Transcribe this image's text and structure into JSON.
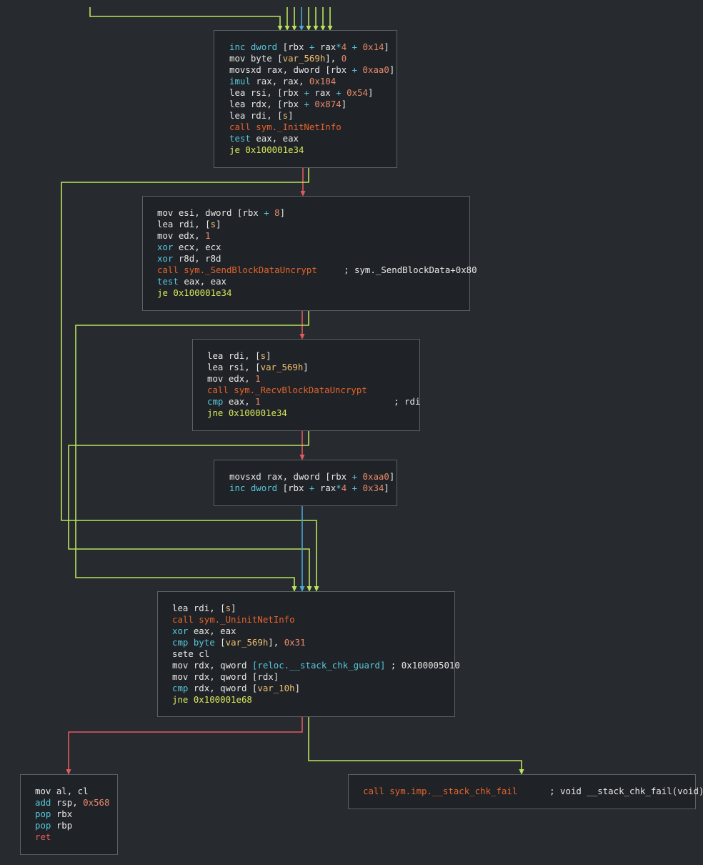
{
  "colors": {
    "bg": "#272b2f",
    "node_bg": "#1f2226",
    "node_border": "#5c6166",
    "edge_true": "#b9e35c",
    "edge_false": "#e0595f",
    "edge_uncond": "#4aa8d4",
    "text": "#e8e8e8",
    "register_keyword": "#56c8dc",
    "call": "#e8642c",
    "jump": "#d8e85c",
    "ret": "#e85c5c",
    "number": "#e88a6c",
    "var": "#f0c070"
  },
  "nodes": {
    "init": {
      "lines": [
        [
          [
            "inc dword ",
            "c"
          ],
          [
            "[",
            "w"
          ],
          [
            "rbx",
            "w"
          ],
          [
            " + ",
            "c"
          ],
          [
            "rax",
            "w"
          ],
          [
            "*",
            "c"
          ],
          [
            "4",
            "n"
          ],
          [
            " + ",
            "c"
          ],
          [
            "0x14",
            "n"
          ],
          [
            "]",
            "w"
          ]
        ],
        [
          [
            "mov byte ",
            "w"
          ],
          [
            "[",
            "w"
          ],
          [
            "var_569h",
            "y"
          ],
          [
            "], ",
            "w"
          ],
          [
            "0",
            "n"
          ]
        ],
        [
          [
            "movsxd rax, dword ",
            "w"
          ],
          [
            "[",
            "w"
          ],
          [
            "rbx",
            "w"
          ],
          [
            " + ",
            "c"
          ],
          [
            "0xaa0",
            "n"
          ],
          [
            "]",
            "w"
          ]
        ],
        [
          [
            "imul ",
            "c"
          ],
          [
            "rax, rax, ",
            "w"
          ],
          [
            "0x104",
            "n"
          ]
        ],
        [
          [
            "lea rsi, ",
            "w"
          ],
          [
            "[",
            "w"
          ],
          [
            "rbx",
            "w"
          ],
          [
            " + ",
            "c"
          ],
          [
            "rax",
            "w"
          ],
          [
            " + ",
            "c"
          ],
          [
            "0x54",
            "n"
          ],
          [
            "]",
            "w"
          ]
        ],
        [
          [
            "lea rdx, ",
            "w"
          ],
          [
            "[",
            "w"
          ],
          [
            "rbx",
            "w"
          ],
          [
            " + ",
            "c"
          ],
          [
            "0x874",
            "n"
          ],
          [
            "]",
            "w"
          ]
        ],
        [
          [
            "lea rdi, ",
            "w"
          ],
          [
            "[",
            "w"
          ],
          [
            "s",
            "y"
          ],
          [
            "]",
            "w"
          ]
        ],
        [
          [
            "call sym._InitNetInfo",
            "o"
          ]
        ],
        [
          [
            "test ",
            "c"
          ],
          [
            "eax, eax",
            "w"
          ]
        ],
        [
          [
            "je 0x100001e34",
            "g"
          ]
        ]
      ]
    },
    "send": {
      "lines": [
        [
          [
            "mov esi, dword ",
            "w"
          ],
          [
            "[",
            "w"
          ],
          [
            "rbx",
            "w"
          ],
          [
            " + ",
            "c"
          ],
          [
            "8",
            "n"
          ],
          [
            "]",
            "w"
          ]
        ],
        [
          [
            "lea rdi, ",
            "w"
          ],
          [
            "[",
            "w"
          ],
          [
            "s",
            "y"
          ],
          [
            "]",
            "w"
          ]
        ],
        [
          [
            "mov edx, ",
            "w"
          ],
          [
            "1",
            "n"
          ]
        ],
        [
          [
            "xor ",
            "c"
          ],
          [
            "ecx, ecx",
            "w"
          ]
        ],
        [
          [
            "xor ",
            "c"
          ],
          [
            "r8d, r8d",
            "w"
          ]
        ],
        [
          [
            "call sym._SendBlockDataUncrypt",
            "o"
          ],
          [
            "     ; sym._SendBlockData+0x80",
            "w"
          ]
        ],
        [
          [
            "test ",
            "c"
          ],
          [
            "eax, eax",
            "w"
          ]
        ],
        [
          [
            "je 0x100001e34",
            "g"
          ]
        ]
      ]
    },
    "recv": {
      "lines": [
        [
          [
            "lea rdi, ",
            "w"
          ],
          [
            "[",
            "w"
          ],
          [
            "s",
            "y"
          ],
          [
            "]",
            "w"
          ]
        ],
        [
          [
            "lea rsi, ",
            "w"
          ],
          [
            "[",
            "w"
          ],
          [
            "var_569h",
            "y"
          ],
          [
            "]",
            "w"
          ]
        ],
        [
          [
            "mov edx, ",
            "w"
          ],
          [
            "1",
            "n"
          ]
        ],
        [
          [
            "call sym._RecvBlockDataUncrypt",
            "o"
          ]
        ],
        [
          [
            "cmp ",
            "c"
          ],
          [
            "eax, ",
            "w"
          ],
          [
            "1",
            "n"
          ],
          [
            "                         ; rdi",
            "w"
          ]
        ],
        [
          [
            "jne 0x100001e34",
            "g"
          ]
        ]
      ]
    },
    "incr": {
      "lines": [
        [
          [
            "movsxd rax, dword ",
            "w"
          ],
          [
            "[",
            "w"
          ],
          [
            "rbx",
            "w"
          ],
          [
            " + ",
            "c"
          ],
          [
            "0xaa0",
            "n"
          ],
          [
            "]",
            "w"
          ]
        ],
        [
          [
            "inc dword ",
            "c"
          ],
          [
            "[",
            "w"
          ],
          [
            "rbx",
            "w"
          ],
          [
            " + ",
            "c"
          ],
          [
            "rax",
            "w"
          ],
          [
            "*",
            "c"
          ],
          [
            "4",
            "n"
          ],
          [
            " + ",
            "c"
          ],
          [
            "0x34",
            "n"
          ],
          [
            "]",
            "w"
          ]
        ]
      ]
    },
    "uninit": {
      "lines": [
        [
          [
            "lea rdi, ",
            "w"
          ],
          [
            "[",
            "w"
          ],
          [
            "s",
            "y"
          ],
          [
            "]",
            "w"
          ]
        ],
        [
          [
            "call sym._UninitNetInfo",
            "o"
          ]
        ],
        [
          [
            "xor ",
            "c"
          ],
          [
            "eax, eax",
            "w"
          ]
        ],
        [
          [
            "cmp byte ",
            "c"
          ],
          [
            "[",
            "w"
          ],
          [
            "var_569h",
            "y"
          ],
          [
            "], ",
            "w"
          ],
          [
            "0x31",
            "n"
          ]
        ],
        [
          [
            "sete cl",
            "w"
          ]
        ],
        [
          [
            "mov rdx, qword ",
            "w"
          ],
          [
            "[reloc.__stack_chk_guard]",
            "c"
          ],
          [
            " ; 0x100005010",
            "w"
          ]
        ],
        [
          [
            "mov rdx, qword ",
            "w"
          ],
          [
            "[",
            "w"
          ],
          [
            "rdx",
            "w"
          ],
          [
            "]",
            "w"
          ]
        ],
        [
          [
            "cmp ",
            "c"
          ],
          [
            "rdx, qword ",
            "w"
          ],
          [
            "[",
            "w"
          ],
          [
            "var_10h",
            "y"
          ],
          [
            "]",
            "w"
          ]
        ],
        [
          [
            "jne 0x100001e68",
            "g"
          ]
        ]
      ]
    },
    "ret": {
      "lines": [
        [
          [
            "mov al, cl",
            "w"
          ]
        ],
        [
          [
            "add ",
            "c"
          ],
          [
            "rsp, ",
            "w"
          ],
          [
            "0x568",
            "n"
          ]
        ],
        [
          [
            "pop ",
            "c"
          ],
          [
            "rbx",
            "w"
          ]
        ],
        [
          [
            "pop ",
            "c"
          ],
          [
            "rbp",
            "w"
          ]
        ],
        [
          [
            "ret",
            "r"
          ]
        ]
      ]
    },
    "fail": {
      "lines": [
        [
          [
            "call sym.imp.__stack_chk_fail",
            "o"
          ],
          [
            "      ; void __stack_chk_fail(void)",
            "w"
          ]
        ]
      ]
    }
  }
}
